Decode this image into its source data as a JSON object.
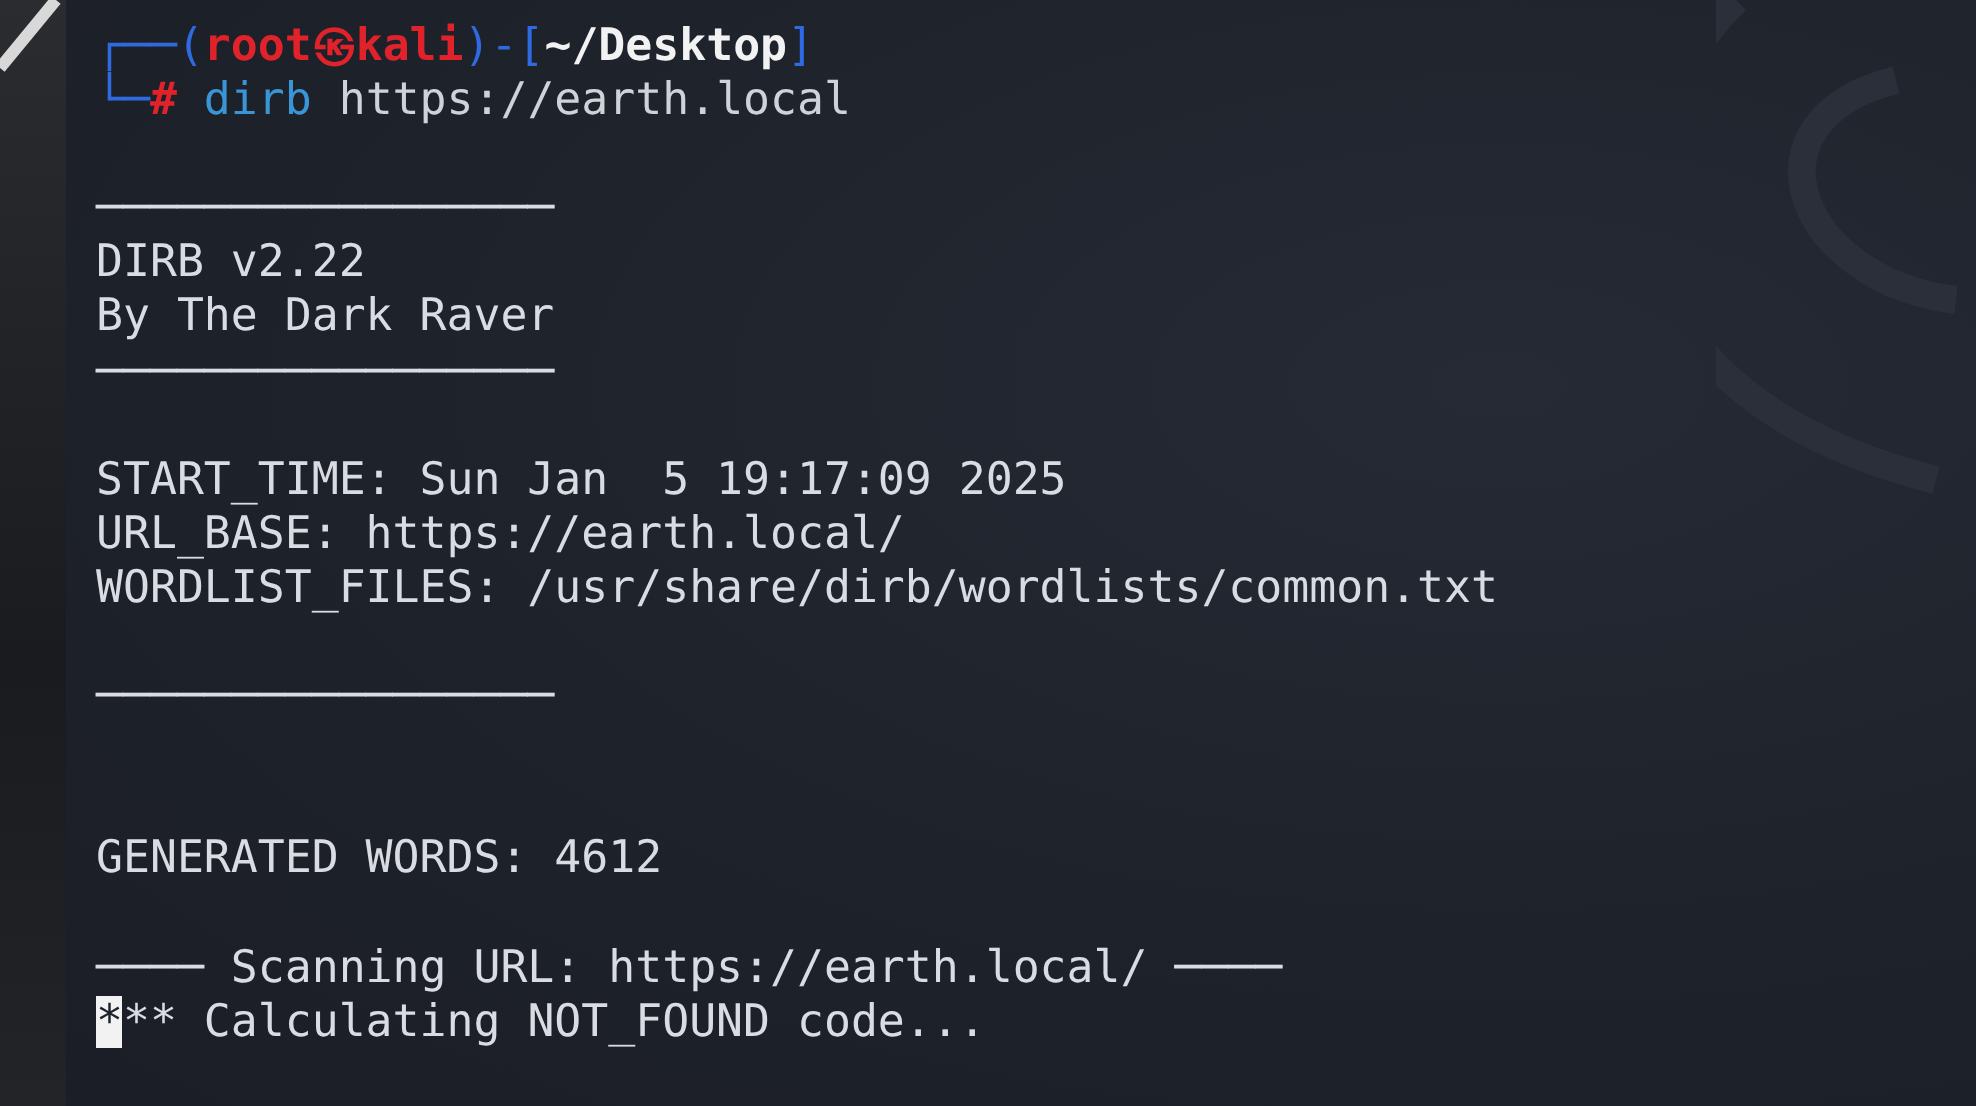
{
  "prompt": [
    [
      {
        "kind": "frame",
        "text": "┌──("
      },
      {
        "kind": "user",
        "text": "root㉿kali"
      },
      {
        "kind": "frame",
        "text": ")-["
      },
      {
        "kind": "path",
        "text": "~/Desktop"
      },
      {
        "kind": "frame",
        "text": "]"
      }
    ],
    [
      {
        "kind": "frame",
        "text": "└─"
      },
      {
        "kind": "user",
        "text": "#"
      },
      {
        "kind": "command",
        "text": " dirb"
      },
      {
        "kind": "arg",
        "text": " https://earth.local"
      }
    ]
  ],
  "lines": [
    {
      "kind": "blank"
    },
    {
      "kind": "rule",
      "text": "─────────────────"
    },
    {
      "kind": "text",
      "text": "DIRB v2.22"
    },
    {
      "kind": "text",
      "text": "By The Dark Raver"
    },
    {
      "kind": "rule",
      "text": "─────────────────"
    },
    {
      "kind": "blank"
    },
    {
      "kind": "text",
      "text": "START_TIME: Sun Jan  5 19:17:09 2025"
    },
    {
      "kind": "text",
      "text": "URL_BASE: https://earth.local/"
    },
    {
      "kind": "text",
      "text": "WORDLIST_FILES: /usr/share/dirb/wordlists/common.txt"
    },
    {
      "kind": "blank"
    },
    {
      "kind": "rule",
      "text": "─────────────────"
    },
    {
      "kind": "blank"
    },
    {
      "kind": "blank"
    },
    {
      "kind": "text",
      "text": "GENERATED WORDS: 4612"
    },
    {
      "kind": "blank"
    },
    {
      "kind": "text",
      "text": "──── Scanning URL: https://earth.local/ ────"
    },
    {
      "kind": "cursor",
      "cursor_char": "*",
      "text": "** Calculating NOT_FOUND code..."
    }
  ]
}
